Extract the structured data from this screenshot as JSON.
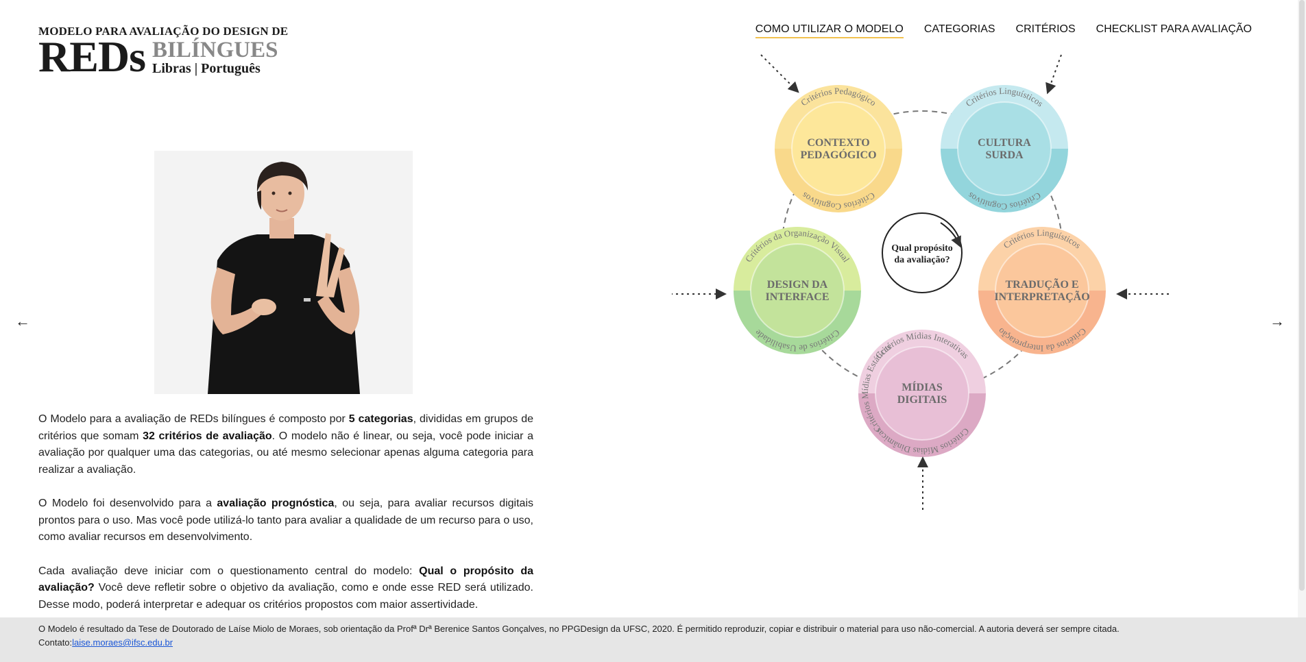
{
  "logo": {
    "top_line": "MODELO PARA AVALIAÇÃO DO DESIGN DE",
    "reds": "REDs",
    "bilingues": "BILÍNGUES",
    "languages": "Libras | Português"
  },
  "nav": [
    {
      "label": "COMO UTILIZAR O MODELO",
      "active": true
    },
    {
      "label": "CATEGORIAS",
      "active": false
    },
    {
      "label": "CRITÉRIOS",
      "active": false
    },
    {
      "label": "CHECKLIST PARA AVALIAÇÃO",
      "active": false
    }
  ],
  "carousel": {
    "prev_icon": "arrow-left-icon",
    "next_icon": "arrow-right-icon",
    "prev": "←",
    "next": "→"
  },
  "intro": {
    "p1": {
      "a": "O Modelo para a avaliação de REDs bilíngues é composto por ",
      "b1": "5 categorias",
      "c": ", divididas em grupos de critérios que somam ",
      "b2": "32 critérios de avaliação",
      "d": ". O modelo não é linear, ou seja, você pode iniciar a avaliação por qualquer uma das categorias, ou até mesmo selecionar apenas alguma categoria para realizar a avaliação."
    },
    "p2": {
      "a": "O Modelo foi desenvolvido para a ",
      "b1": "avaliação prognóstica",
      "c": ", ou seja, para avaliar recursos digitais prontos para o uso. Mas você pode utilizá-lo tanto para avaliar a qualidade de um recurso para o uso, como avaliar recursos em desenvolvimento."
    },
    "p3": {
      "a": "Cada avaliação deve iniciar com o questionamento central do modelo: ",
      "b1": "Qual o propósito da avaliação?",
      "c": " Você deve refletir sobre o objetivo da avaliação, como e onde esse RED será utilizado. Desse modo, poderá interpretar e adequar os critérios propostos com maior assertividade."
    }
  },
  "diagram": {
    "center": [
      "Qual propósito",
      "da avaliação?"
    ],
    "categories": [
      {
        "name": [
          "CONTEXTO",
          "PEDAGÓGICO"
        ],
        "top": "Critérios Pedagógico",
        "bottom": "Critérios Cognitivos",
        "color_top": "#fbe39c",
        "color_bottom": "#f9d98b",
        "color_inner": "#fde79a"
      },
      {
        "name": [
          "CULTURA",
          "SURDA"
        ],
        "top": "Critérios Linguísticos",
        "bottom": "Critérios Cognitivos",
        "color_top": "#c5e9ef",
        "color_bottom": "#93d5dc",
        "color_inner": "#a9dfe5"
      },
      {
        "name": [
          "TRADUÇÃO E",
          "INTERPRETAÇÃO"
        ],
        "top": "Critérios Linguísticos",
        "bottom": "Critérios da Interpretação",
        "color_top": "#fcd2a8",
        "color_bottom": "#f8b48e",
        "color_inner": "#fbc79c"
      },
      {
        "name": [
          "MÍDIAS",
          "DIGITAIS"
        ],
        "top": "Critérios Mídias Interativas",
        "left": "Critérios Mídias Estáticas",
        "bottom": "Critérios Mídias Dinâmicas",
        "color_top": "#efcfe0",
        "color_bottom": "#dca9c4",
        "color_inner": "#e8bfd6"
      },
      {
        "name": [
          "DESIGN DA",
          "INTERFACE"
        ],
        "top": "Critérios da Organização Visual",
        "bottom": "Critérios de Usabilidade",
        "color_top": "#d8ec9d",
        "color_bottom": "#a7d99a",
        "color_inner": "#c3e39b"
      }
    ]
  },
  "footer": {
    "text": "O Modelo é resultado da Tese de Doutorado de Laíse Miolo de Moraes, sob orientação da Profª Drª Berenice Santos Gonçalves, no PPGDesign da UFSC, 2020. É permitido reproduzir, copiar e distribuir o material para uso não-comercial. A autoria deverá ser sempre citada.",
    "contact_label": "Contato:",
    "email": "laise.moraes@ifsc.edu.br"
  }
}
